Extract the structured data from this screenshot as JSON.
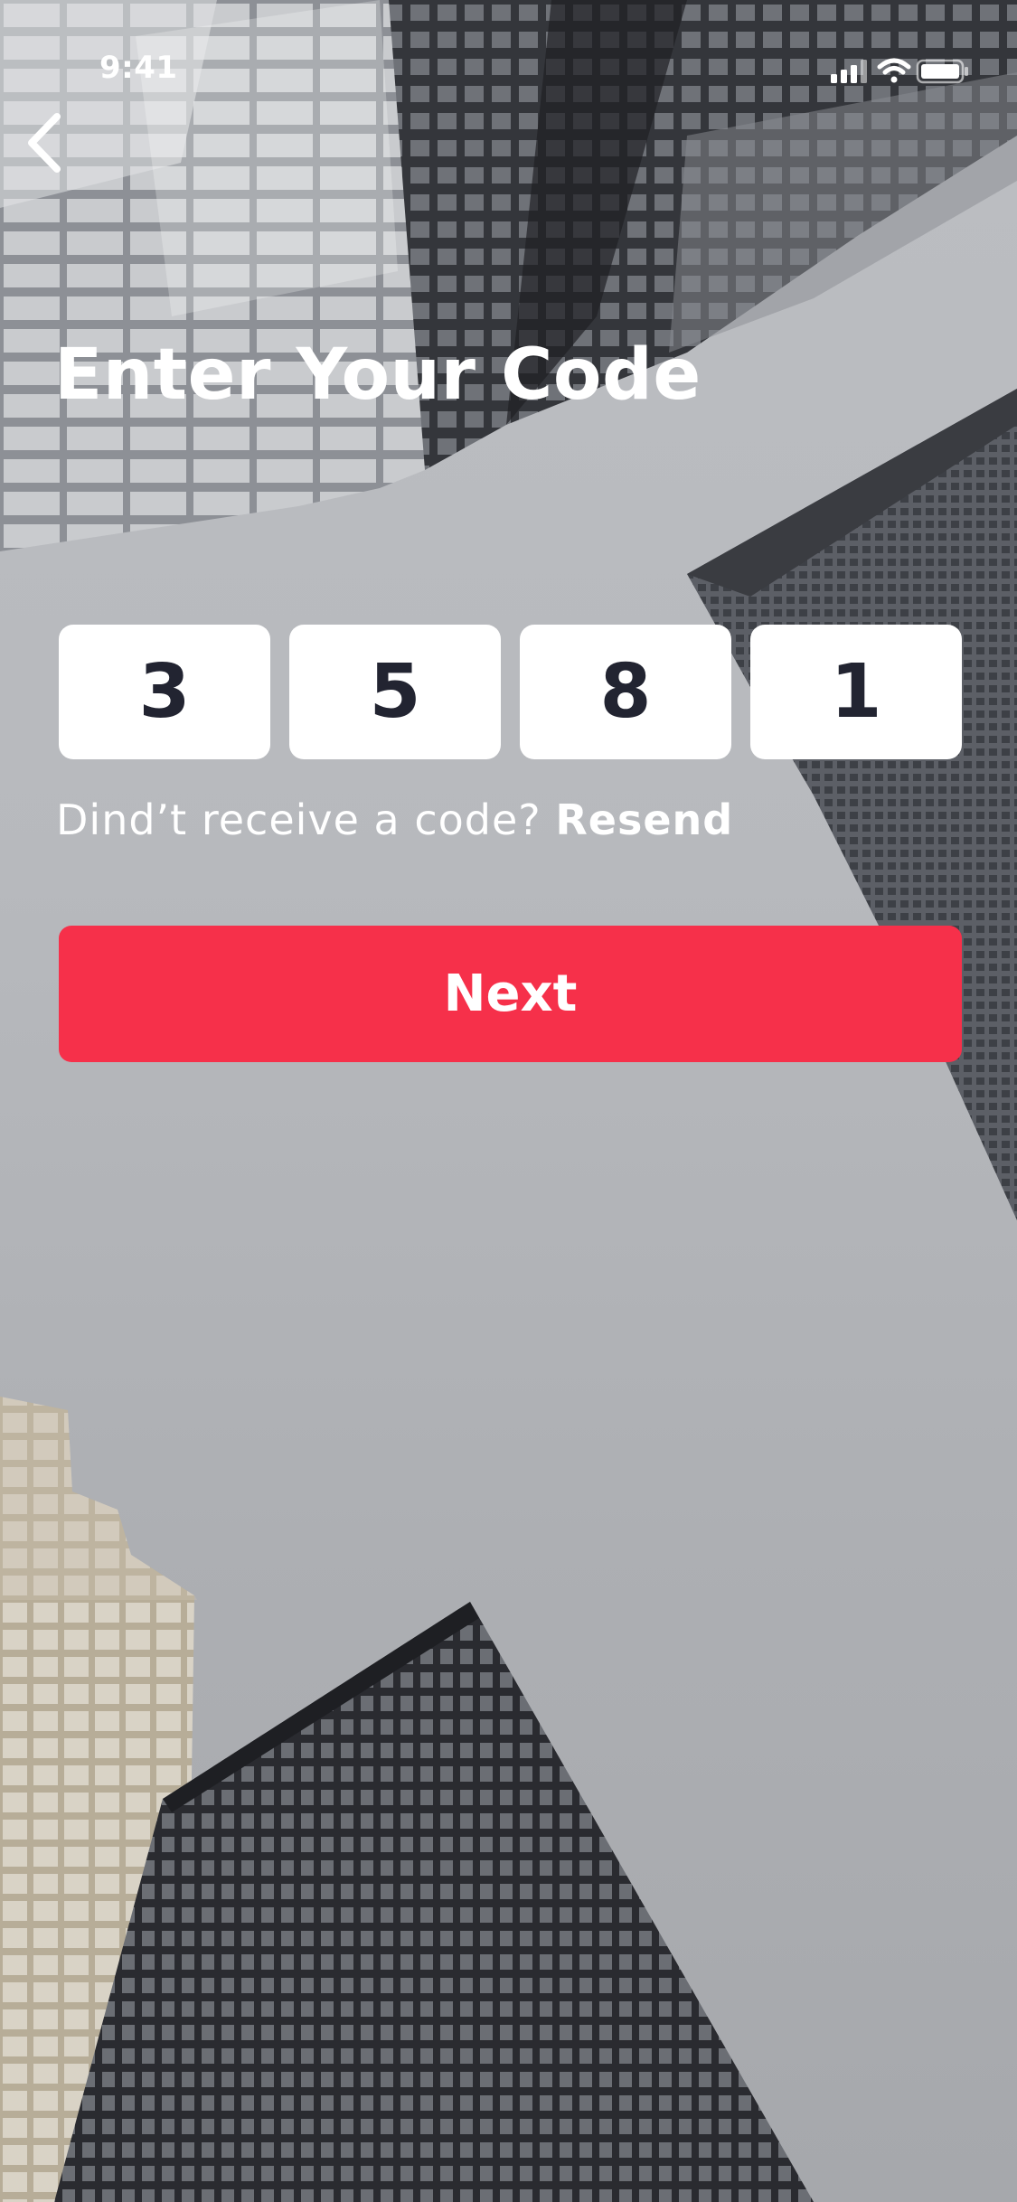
{
  "status_bar": {
    "time": "9:41",
    "icons": [
      "signal-icon",
      "wifi-icon",
      "battery-icon"
    ]
  },
  "header": {
    "back_icon": "chevron-left-icon",
    "title": "Enter Your Code"
  },
  "code": {
    "digits": [
      "3",
      "5",
      "8",
      "1"
    ]
  },
  "resend": {
    "prompt": "Dind’t receive a code?",
    "link_label": "Resend"
  },
  "actions": {
    "next_label": "Next"
  },
  "colors": {
    "accent": "#f6304a",
    "digit_text": "#222431",
    "box_bg": "#ffffff"
  }
}
